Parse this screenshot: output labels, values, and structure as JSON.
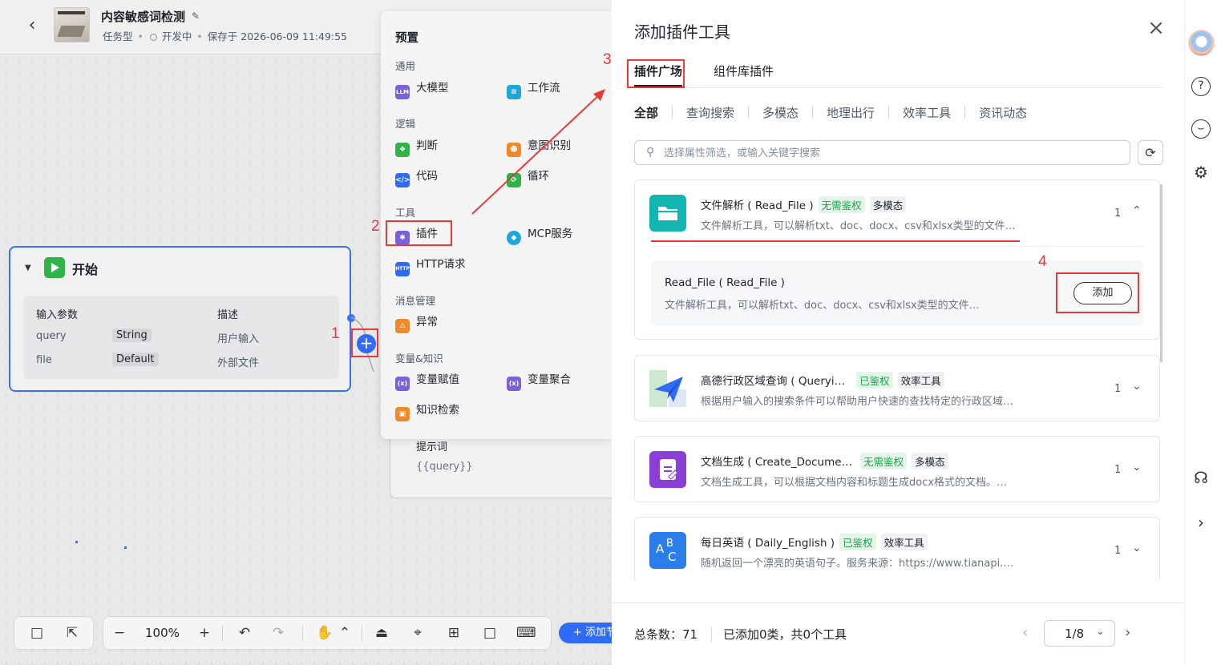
{
  "header": {
    "title": "内容敏感词检测",
    "type": "任务型",
    "status": "开发中",
    "saved": "保存于 2026-06-09 11:49:55"
  },
  "start_node": {
    "title": "开始",
    "col_param": "输入参数",
    "col_desc": "描述",
    "rows": [
      {
        "name": "query",
        "type": "String",
        "desc": "用户输入"
      },
      {
        "name": "file",
        "type": "Default",
        "desc": "外部文件"
      }
    ]
  },
  "llm_node": {
    "label": "提示词",
    "value": "{{query}}"
  },
  "annotations": [
    "1",
    "2",
    "3",
    "4"
  ],
  "toolbar": {
    "zoom": "100%",
    "add_node": "+ 添加节点"
  },
  "picker": {
    "title": "预置",
    "sections": {
      "general": "通用",
      "logic": "逻辑",
      "tools": "工具",
      "message": "消息管理",
      "variables": "变量&知识"
    },
    "items": {
      "llm": "大模型",
      "workflow": "工作流",
      "judge": "判断",
      "intent": "意图识别",
      "code": "代码",
      "loop": "循环",
      "plugin": "插件",
      "mcp": "MCP服务",
      "http": "HTTP请求",
      "exception": "异常",
      "var_assign": "变量赋值",
      "var_merge": "变量聚合",
      "knowledge": "知识检索"
    },
    "icon_texts": {
      "llm": "LLM",
      "http": "HTTP"
    }
  },
  "drawer": {
    "title": "添加插件工具",
    "tabs": [
      "插件广场",
      "组件库插件"
    ],
    "categories": [
      "全部",
      "查询搜索",
      "多模态",
      "地理出行",
      "效率工具",
      "资讯动态"
    ],
    "search_placeholder": "选择属性筛选，或输入关键字搜索",
    "plugins": [
      {
        "name": "文件解析 ( Read_File )",
        "badges": [
          "无需鉴权",
          "多模态"
        ],
        "desc": "文件解析工具，可以解析txt、doc、docx、csv和xlsx类型的文件…",
        "count": "1",
        "tool": {
          "name": "Read_File ( Read_File )",
          "desc": "文件解析工具，可以解析txt、doc、docx、csv和xlsx类型的文件…",
          "add_label": "添加"
        }
      },
      {
        "name": "高德行政区域查询 ( Queryi…",
        "badges": [
          "已鉴权",
          "效率工具"
        ],
        "desc": "根据用户输入的搜索条件可以帮助用户快速的查找特定的行政区域…",
        "count": "1"
      },
      {
        "name": "文档生成 ( Create_Docume…",
        "badges": [
          "无需鉴权",
          "多模态"
        ],
        "desc": "文档生成工具，可以根据文档内容和标题生成docx格式的文档。…",
        "count": "1"
      },
      {
        "name": "每日英语 ( Daily_English )",
        "badges": [
          "已鉴权",
          "效率工具"
        ],
        "desc": "随机返回一个漂亮的英语句子。服务来源：https://www.tianapi.…",
        "count": "1"
      }
    ],
    "footer": {
      "total": "总条数：71",
      "added": "已添加0类，共0个工具",
      "page": "1/8"
    }
  },
  "colors": {
    "accent": "#2f6bf5",
    "annotation": "#e8393b",
    "badge_green_bg": "#e3f6e8",
    "badge_green_text": "#1aa14c"
  }
}
